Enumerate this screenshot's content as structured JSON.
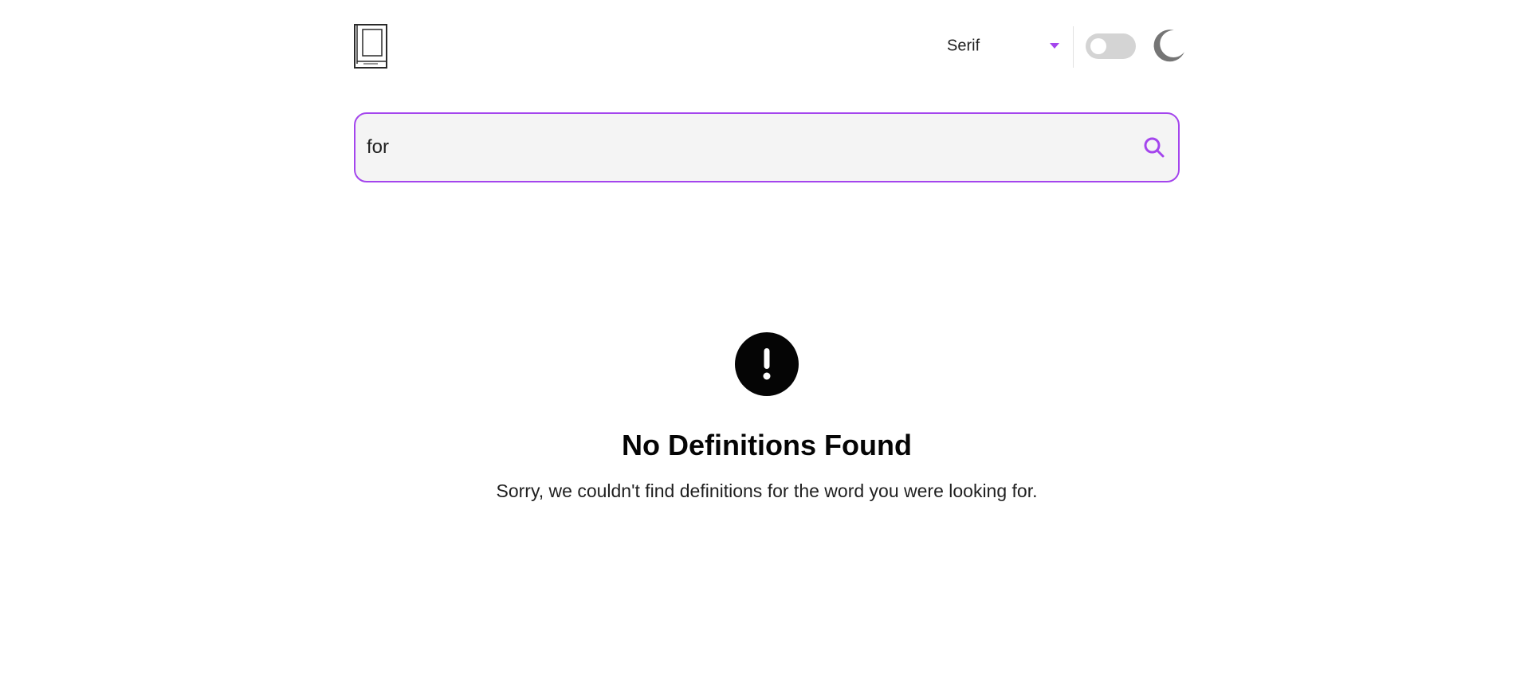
{
  "header": {
    "logo_icon": "book-icon",
    "font_selector": {
      "selected": "Serif",
      "caret_icon": "chevron-down-icon"
    },
    "theme_toggle": {
      "state": "off"
    },
    "theme_icon": "moon-icon"
  },
  "search": {
    "value": "for",
    "icon": "search-icon"
  },
  "empty_state": {
    "icon": "exclamation-icon",
    "title": "No Definitions Found",
    "message": "Sorry, we couldn't find definitions for the word you were looking for."
  },
  "colors": {
    "accent": "#a445ed",
    "input_bg": "#f4f4f4",
    "toggle_bg": "#d4d4d4",
    "moon": "#757575",
    "text": "#050505"
  }
}
